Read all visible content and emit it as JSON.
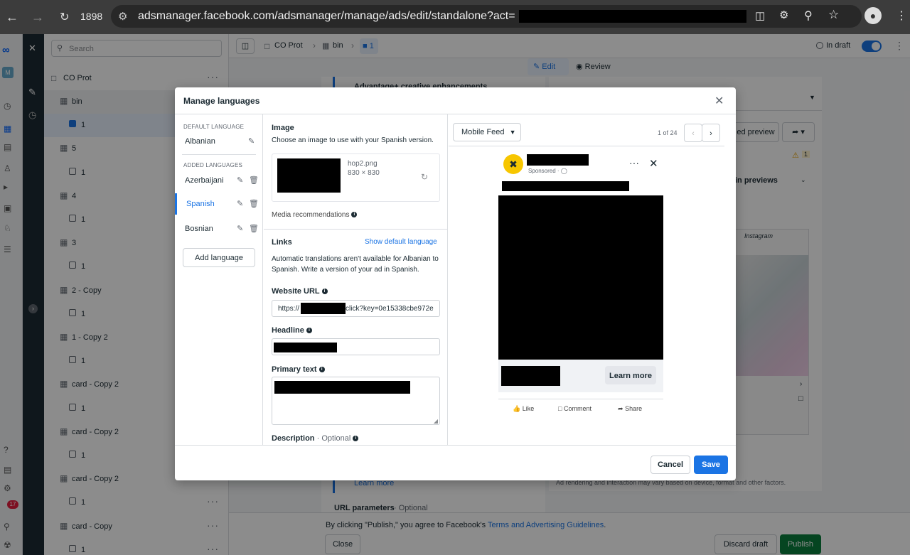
{
  "browser": {
    "tab_count": "1898",
    "url": "adsmanager.facebook.com/adsmanager/manage/ads/edit/standalone?act="
  },
  "sidebar_search": {
    "placeholder": "Search"
  },
  "tree": {
    "root": "CO Prot",
    "items": [
      {
        "label": "bin",
        "type": "group"
      },
      {
        "label": "1",
        "type": "ad"
      },
      {
        "label": "5",
        "type": "group"
      },
      {
        "label": "1",
        "type": "ad"
      },
      {
        "label": "4",
        "type": "group"
      },
      {
        "label": "1",
        "type": "ad"
      },
      {
        "label": "3",
        "type": "group"
      },
      {
        "label": "1",
        "type": "ad"
      },
      {
        "label": "2 - Copy",
        "type": "group"
      },
      {
        "label": "1",
        "type": "ad"
      },
      {
        "label": "1 - Copy 2",
        "type": "group"
      },
      {
        "label": "1",
        "type": "ad"
      },
      {
        "label": "card - Copy 2",
        "type": "group"
      },
      {
        "label": "1",
        "type": "ad"
      },
      {
        "label": "card - Copy 2",
        "type": "group"
      },
      {
        "label": "1",
        "type": "ad"
      },
      {
        "label": "card - Copy 2",
        "type": "group"
      },
      {
        "label": "1",
        "type": "ad"
      },
      {
        "label": "card - Copy",
        "type": "group"
      },
      {
        "label": "1",
        "type": "ad"
      }
    ]
  },
  "breadcrumb": {
    "campaign": "CO Prot",
    "adset": "bin",
    "ad": "1"
  },
  "status": "In draft",
  "edit_tabs": {
    "edit": "Edit",
    "review": "Review"
  },
  "notification_count": "17",
  "background": {
    "advantage": "Advantage+ creative enhancements",
    "learn_more": "Learn more",
    "url_params": "URL parameters",
    "optional": "Optional",
    "preview_btn": "ed preview",
    "in_previews": "in previews",
    "warning_count": "1",
    "disclaimer": "Ad rendering and interaction may vary based on device, format and other factors.",
    "instagram": "Instagram"
  },
  "footer": {
    "agree_prefix": "By clicking \"Publish,\" you agree to Facebook's ",
    "agree_link": "Terms and Advertising Guidelines",
    "agree_suffix": ".",
    "close": "Close",
    "discard": "Discard draft",
    "publish": "Publish"
  },
  "modal": {
    "title": "Manage languages",
    "default_language_caption": "Default language",
    "default_language": "Albanian",
    "added_languages_caption": "Added languages",
    "added_languages": [
      "Azerbaijani",
      "Spanish",
      "Bosnian"
    ],
    "add_language": "Add language",
    "image": {
      "heading": "Image",
      "desc": "Choose an image to use with your Spanish version.",
      "filename": "hop2.png",
      "dimensions": "830 × 830",
      "media_recommendations": "Media recommendations"
    },
    "links": {
      "heading": "Links",
      "show_default": "Show default language",
      "note": "Automatic translations aren't available for Albanian to Spanish. Write a version of your ad in Spanish."
    },
    "website_url": {
      "label": "Website URL",
      "prefix": "https://",
      "value": "click?key=0e15338cbe972e"
    },
    "headline": {
      "label": "Headline"
    },
    "primary_text": {
      "label": "Primary text"
    },
    "description": {
      "label": "Description",
      "optional": "Optional"
    },
    "preview": {
      "placement": "Mobile Feed",
      "counter": "1 of 24",
      "sponsored": "Sponsored · ",
      "cta": "Learn more",
      "like": "Like",
      "comment": "Comment",
      "share": "Share"
    },
    "cancel": "Cancel",
    "save": "Save"
  },
  "colors": {
    "accent": "#1b74e4",
    "publish": "#0a7e3c",
    "rail": "#1c2b33"
  }
}
